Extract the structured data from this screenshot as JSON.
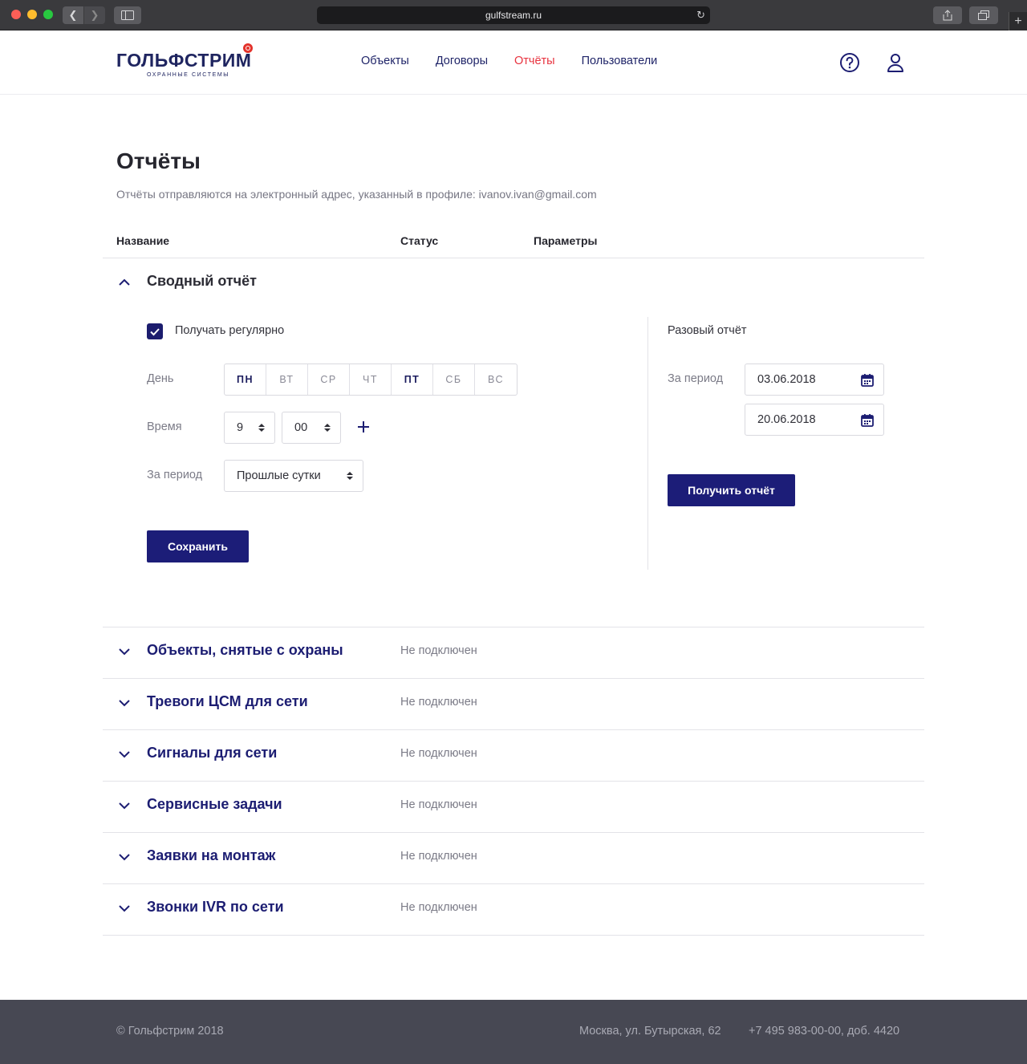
{
  "browser": {
    "url": "gulfstream.ru"
  },
  "header": {
    "logo_main": "ГОЛЬФСТРИМ",
    "logo_sub": "охранные системы",
    "nav": [
      {
        "label": "Объекты",
        "active": false
      },
      {
        "label": "Договоры",
        "active": false
      },
      {
        "label": "Отчёты",
        "active": true
      },
      {
        "label": "Пользователи",
        "active": false
      }
    ],
    "help_icon": "help-circle-icon",
    "user_icon": "user-icon"
  },
  "page": {
    "title": "Отчёты",
    "subtitle": "Отчёты отправляются на электронный адрес, указанный в профиле: ivanov.ivan@gmail.com"
  },
  "table": {
    "columns": {
      "name": "Название",
      "status": "Статус",
      "params": "Параметры"
    }
  },
  "summary_report": {
    "title": "Сводный отчёт",
    "regular_label": "Получать регулярно",
    "regular_checked": true,
    "day_label": "День",
    "days": [
      {
        "label": "ПН",
        "selected": true
      },
      {
        "label": "ВТ",
        "selected": false
      },
      {
        "label": "СР",
        "selected": false
      },
      {
        "label": "ЧТ",
        "selected": false
      },
      {
        "label": "ПТ",
        "selected": true
      },
      {
        "label": "СБ",
        "selected": false
      },
      {
        "label": "ВС",
        "selected": false
      }
    ],
    "time_label": "Время",
    "hour": "9",
    "minute": "00",
    "period_label": "За период",
    "period_value": "Прошлые сутки",
    "save_label": "Сохранить",
    "oneoff": {
      "title": "Разовый отчёт",
      "period_label": "За период",
      "date_from": "03.06.2018",
      "date_to": "20.06.2018",
      "get_label": "Получить отчёт"
    }
  },
  "reports": [
    {
      "title": "Объекты, снятые с охраны",
      "status": "Не подключен"
    },
    {
      "title": "Тревоги ЦСМ для сети",
      "status": "Не подключен"
    },
    {
      "title": "Сигналы для сети",
      "status": "Не подключен"
    },
    {
      "title": "Сервисные задачи",
      "status": "Не подключен"
    },
    {
      "title": "Заявки на монтаж",
      "status": "Не подключен"
    },
    {
      "title": "Звонки IVR по сети",
      "status": "Не подключен"
    }
  ],
  "footer": {
    "copyright": "© Гольфстрим 2018",
    "address": "Москва, ул. Бутырская, 62",
    "phone": "+7 495 983-00-00, доб. 4420"
  },
  "colors": {
    "brand": "#1c1d78",
    "accent": "#e8333f",
    "footer_bg": "#474853"
  }
}
